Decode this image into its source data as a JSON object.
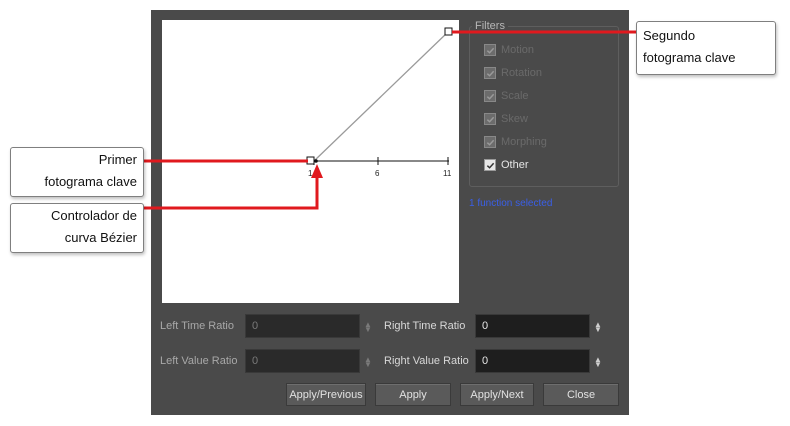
{
  "filters": {
    "title": "Filters",
    "items": [
      {
        "label": "Motion",
        "checked": true,
        "enabled": false
      },
      {
        "label": "Rotation",
        "checked": true,
        "enabled": false
      },
      {
        "label": "Scale",
        "checked": true,
        "enabled": false
      },
      {
        "label": "Skew",
        "checked": true,
        "enabled": false
      },
      {
        "label": "Morphing",
        "checked": true,
        "enabled": false
      },
      {
        "label": "Other",
        "checked": true,
        "enabled": true
      }
    ]
  },
  "status": {
    "selection": "1 function selected"
  },
  "graph": {
    "ticks": [
      "1",
      "6",
      "11"
    ]
  },
  "ratios": {
    "left_time": {
      "label": "Left Time Ratio",
      "value": "0"
    },
    "right_time": {
      "label": "Right Time Ratio",
      "value": "0"
    },
    "left_value": {
      "label": "Left Value Ratio",
      "value": "0"
    },
    "right_value": {
      "label": "Right Value Ratio",
      "value": "0"
    }
  },
  "buttons": {
    "apply_previous": "Apply/Previous",
    "apply": "Apply",
    "apply_next": "Apply/Next",
    "close": "Close"
  },
  "callouts": {
    "primer_line1": "Primer",
    "primer_line2": "fotograma clave",
    "controlador_line1": "Controlador de",
    "controlador_line2": "curva Bézier",
    "segundo_line1": "Segundo",
    "segundo_line2": "fotograma clave"
  },
  "colors": {
    "annotation": "#e0191e",
    "selection_text": "#3a5fe8",
    "dialog_bg": "#4a4a4a"
  }
}
